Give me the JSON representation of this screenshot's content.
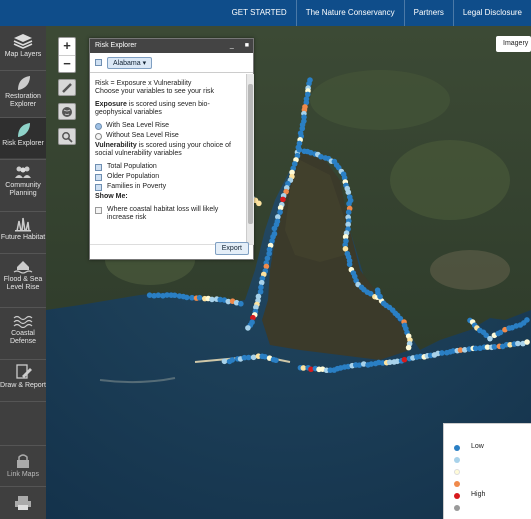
{
  "topbar": {
    "links": [
      "GET STARTED",
      "The Nature Conservancy",
      "Partners",
      "Legal Disclosure"
    ]
  },
  "sidebar": {
    "items": [
      {
        "label": "Map Layers",
        "icon": "layers-icon"
      },
      {
        "label": "Restoration Explorer",
        "icon": "leaf-icon"
      },
      {
        "label": "Risk Explorer",
        "icon": "leaf-active-icon"
      },
      {
        "label": "Community Planning",
        "icon": "people-icon"
      },
      {
        "label": "Future Habitat",
        "icon": "grass-icon"
      },
      {
        "label": "Flood & Sea Level Rise",
        "icon": "house-water-icon"
      },
      {
        "label": "Coastal Defense",
        "icon": "waves-icon"
      },
      {
        "label": "Draw & Report",
        "icon": "draw-report-icon"
      },
      {
        "label": "Link Maps",
        "icon": "lock-icon"
      },
      {
        "label": "",
        "icon": "print-icon"
      }
    ]
  },
  "map": {
    "zoom_in": "+",
    "zoom_out": "−",
    "imagery_button": "Imagery"
  },
  "panel": {
    "title": "Risk Explorer",
    "region": "Alabama",
    "intro_1": "Risk = Exposure x Vulnerability",
    "intro_2": "Choose your variables to see your risk",
    "exposure_bold": "Exposure",
    "exposure_rest": " is scored using seven bio-geophysical variables",
    "exposure_options": [
      "With Sea Level Rise",
      "Without Sea Level Rise"
    ],
    "vulnerability_bold": "Vulnerability",
    "vulnerability_rest": " is scored using your choice of social vulnerability variables",
    "vulnerability_options": [
      "Total Population",
      "Older Population",
      "Families in Poverty"
    ],
    "show_me": "Show Me:",
    "show_me_option": "Where coastal habitat loss will likely increase risk",
    "export": "Export"
  },
  "legend": {
    "low": "Low",
    "high": "High",
    "colors": [
      "#2a7fc4",
      "#a8d2ea",
      "#fffbd8",
      "#fde3a0",
      "#f08a4b",
      "#d7191c",
      "#9a9a9a"
    ]
  },
  "colors": {
    "topbar": "#0f4d8a",
    "sidebar": "#3f3f3f",
    "low": "#2a7fc4",
    "high": "#d7191c"
  }
}
